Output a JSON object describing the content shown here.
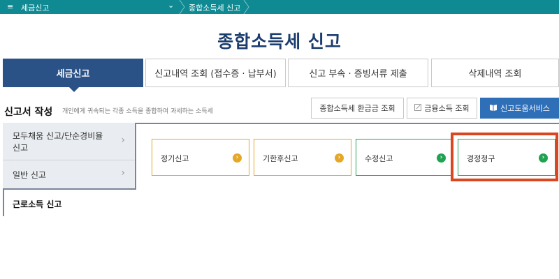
{
  "topbar": {
    "menu_icon": "≡",
    "crumb1": "세금신고",
    "chevron": "⌄",
    "crumb2": "종합소득세 신고"
  },
  "page_title": "종합소득세 신고",
  "tabs": [
    {
      "label": "세금신고"
    },
    {
      "label": "신고내역 조회 (접수증 · 납부서)"
    },
    {
      "label": "신고 부속 · 증빙서류 제출"
    },
    {
      "label": "삭제내역 조회"
    }
  ],
  "section": {
    "title": "신고서 작성",
    "desc": "개인에게 귀속되는 각종 소득을 종합하여 과세하는 소득세"
  },
  "buttons": {
    "refund": "종합소득세 환급금 조회",
    "finance": "금융소득 조회",
    "help": "신고도움서비스"
  },
  "side_menu": [
    {
      "label_line1": "모두채움 신고/단순경비율",
      "label_line2": "신고"
    },
    {
      "label": "일반 신고"
    },
    {
      "label": "근로소득 신고"
    }
  ],
  "cards": [
    {
      "label": "정기신고",
      "color": "#e5a724"
    },
    {
      "label": "기한후신고",
      "color": "#e5a724"
    },
    {
      "label": "수정신고",
      "color": "#1fa350"
    },
    {
      "label": "경정청구",
      "color": "#1fa350"
    }
  ],
  "colors": {
    "topbar": "#0f8a93",
    "title": "#1b3d6e",
    "active_tab": "#2a5286",
    "highlight": "#d9461f"
  }
}
